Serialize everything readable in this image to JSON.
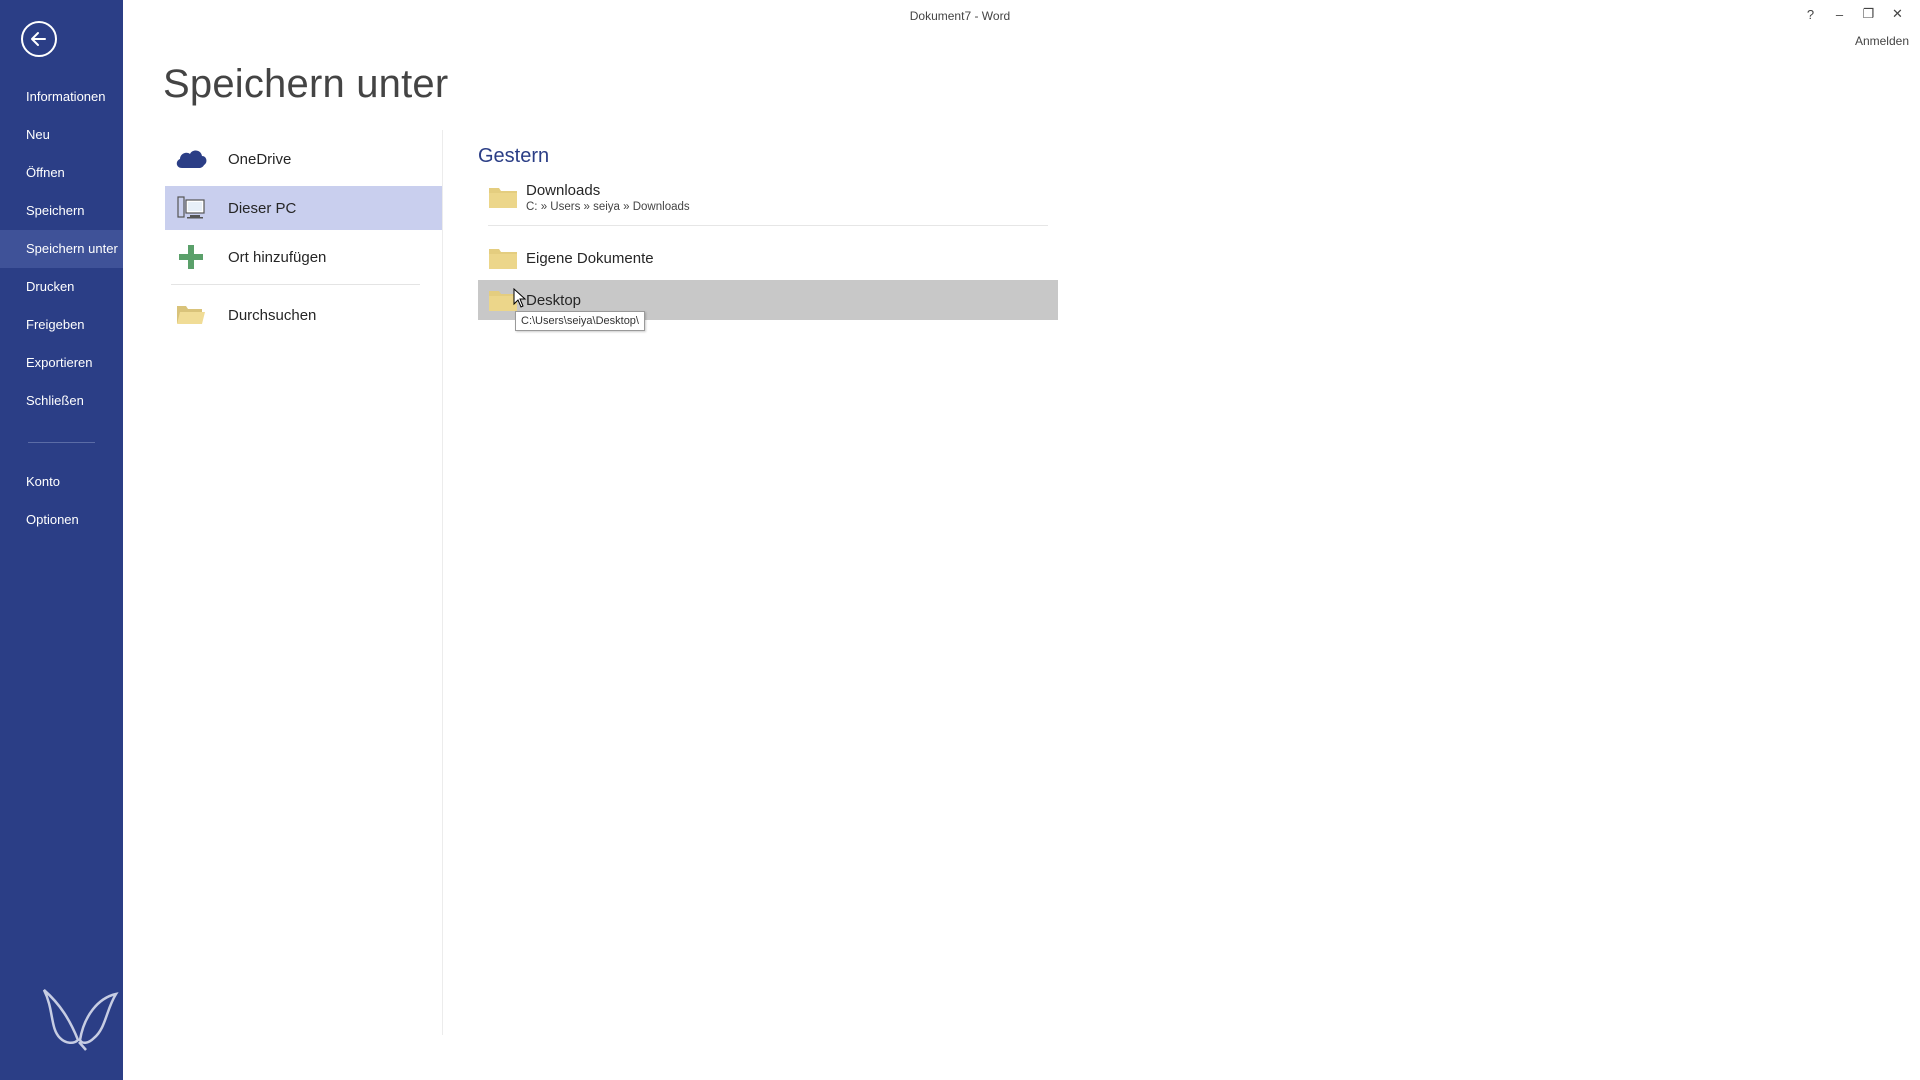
{
  "window": {
    "title": "Dokument7 - Word",
    "help_label": "?",
    "minimize_label": "–",
    "restore_label": "❐",
    "close_label": "✕",
    "signin_label": "Anmelden"
  },
  "sidebar": {
    "items": [
      {
        "label": "Informationen"
      },
      {
        "label": "Neu"
      },
      {
        "label": "Öffnen"
      },
      {
        "label": "Speichern"
      },
      {
        "label": "Speichern unter"
      },
      {
        "label": "Drucken"
      },
      {
        "label": "Freigeben"
      },
      {
        "label": "Exportieren"
      },
      {
        "label": "Schließen"
      }
    ],
    "footer_items": [
      {
        "label": "Konto"
      },
      {
        "label": "Optionen"
      }
    ],
    "active": "Speichern unter",
    "background": "#2b3e86"
  },
  "main": {
    "title": "Speichern unter",
    "locations": [
      {
        "label": "OneDrive",
        "icon": "cloud-icon"
      },
      {
        "label": "Dieser PC",
        "icon": "computer-icon",
        "selected": true
      },
      {
        "label": "Ort hinzufügen",
        "icon": "plus-icon"
      },
      {
        "label": "Durchsuchen",
        "icon": "folder-open-icon"
      }
    ],
    "recent": {
      "heading": "Gestern",
      "folders": [
        {
          "name": "Downloads",
          "path": "C: » Users » seiya » Downloads"
        },
        {
          "name": "Eigene Dokumente"
        },
        {
          "name": "Desktop",
          "hovered": true
        }
      ],
      "tooltip": "C:\\Users\\seiya\\Desktop\\"
    }
  },
  "colors": {
    "accent": "#2b3e86",
    "selected_location": "#c9cfee",
    "hover_row": "#c8c8c8",
    "folder": "#ecd68a"
  }
}
